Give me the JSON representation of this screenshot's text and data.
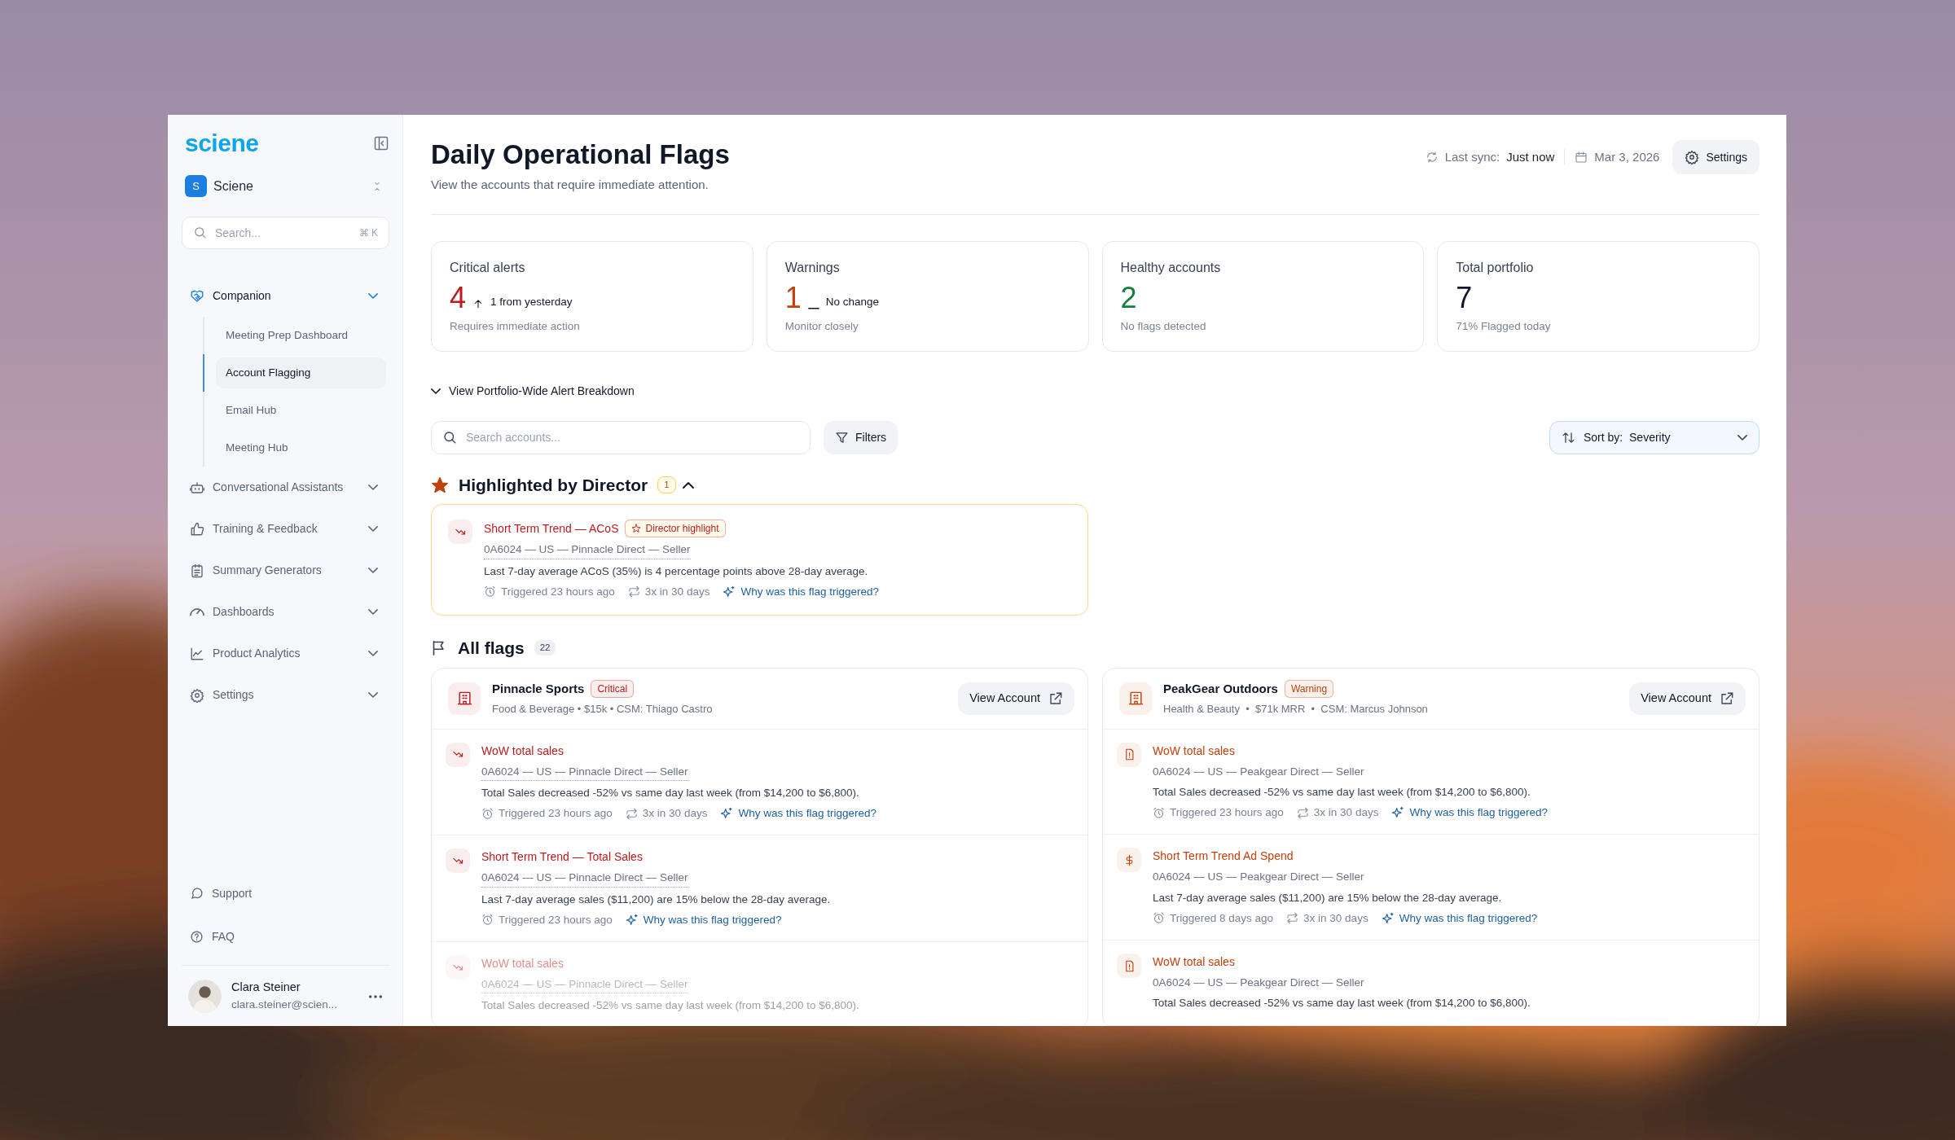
{
  "sidebar": {
    "brand": "sciene",
    "workspace": {
      "initial": "S",
      "name": "Sciene"
    },
    "search": {
      "placeholder": "Search...",
      "shortcut": "⌘ K"
    },
    "nav": [
      {
        "label": "Companion",
        "kind": "handshake",
        "expanded": true,
        "children": [
          {
            "label": "Meeting Prep Dashboard",
            "selected": false
          },
          {
            "label": "Account Flagging",
            "selected": true
          },
          {
            "label": "Email Hub",
            "selected": false
          },
          {
            "label": "Meeting Hub",
            "selected": false
          }
        ]
      },
      {
        "label": "Conversational Assistants",
        "kind": "robot",
        "expanded": false
      },
      {
        "label": "Training & Feedback",
        "kind": "thumbs",
        "expanded": false
      },
      {
        "label": "Summary Generators",
        "kind": "clipboard",
        "expanded": false
      },
      {
        "label": "Dashboards",
        "kind": "gauge",
        "expanded": false
      },
      {
        "label": "Product Analytics",
        "kind": "chart",
        "expanded": false
      },
      {
        "label": "Settings",
        "kind": "gear",
        "expanded": false
      }
    ],
    "footer_links": [
      {
        "label": "Support",
        "kind": "chat"
      },
      {
        "label": "FAQ",
        "kind": "question"
      }
    ],
    "user": {
      "name": "Clara Steiner",
      "email": "clara.steiner@scien..."
    }
  },
  "header": {
    "title": "Daily Operational Flags",
    "subtitle": "View the accounts that require immediate attention.",
    "sync_label": "Last sync:",
    "sync_value": "Just now",
    "date": "Mar 3, 2026",
    "settings_button": "Settings"
  },
  "stats": [
    {
      "label": "Critical alerts",
      "value": "4",
      "color": "#b91c1c",
      "delta": {
        "kind": "up",
        "text": "1 from yesterday"
      },
      "note": "Requires immediate action"
    },
    {
      "label": "Warnings",
      "value": "1",
      "color": "#c2410c",
      "delta": {
        "kind": "flat",
        "text": "No change"
      },
      "note": "Monitor closely"
    },
    {
      "label": "Healthy accounts",
      "value": "2",
      "color": "#15803d",
      "note": "No flags detected"
    },
    {
      "label": "Total portfolio",
      "value": "7",
      "color": "#111827",
      "note": "71% Flagged today"
    }
  ],
  "breakdown_toggle": {
    "label": "View Portfolio-Wide Alert Breakdown",
    "expanded": false
  },
  "toolbar": {
    "search_placeholder": "Search accounts...",
    "filters_button": "Filters",
    "sort_label": "Sort by:",
    "sort_value": "Severity"
  },
  "highlighted": {
    "title": "Highlighted by Director",
    "count": "1",
    "expanded": true,
    "items": [
      {
        "kind": "trend",
        "color": "#b91c1c",
        "title": "Short Term Trend — ACoS",
        "badge": "Director highlight",
        "source": "0A6024 — US — Pinnacle Direct — Seller",
        "underlined": true,
        "description": "Last 7-day average ACoS (35%) is 4 percentage points above 28-day average.",
        "triggered": "Triggered 23 hours ago",
        "repeat": "3x in 30 days",
        "link": "Why was this flag triggered?",
        "faded": false
      }
    ]
  },
  "all_flags": {
    "title": "All flags",
    "count": "22",
    "accounts": [
      {
        "name": "Pinnacle Sports",
        "color": "#b91c1c",
        "badge": "Critical",
        "meta": "Food & Beverage • $15k • CSM: Thiago Castro",
        "button": "View Account",
        "flags": [
          {
            "kind": "trend",
            "title": "WoW total sales",
            "source": "0A6024 — US — Pinnacle Direct — Seller",
            "underlined": true,
            "description": "Total Sales decreased -52% vs same day last week (from $14,200 to $6,800).",
            "triggered": "Triggered 23 hours ago",
            "repeat": "3x in 30 days",
            "link": "Why was this flag triggered?",
            "faded": false
          },
          {
            "kind": "trend",
            "title": "Short Term Trend — Total Sales",
            "source": "0A6024 — US — Pinnacle Direct — Seller",
            "underlined": true,
            "description": "Last 7-day average sales ($11,200) are 15% below the 28-day average.",
            "triggered": "Triggered 23 hours ago",
            "link": "Why was this flag triggered?",
            "faded": false
          },
          {
            "kind": "trend",
            "title": "WoW total sales",
            "source": "0A6024 — US — Pinnacle Direct — Seller",
            "underlined": true,
            "description": "Total Sales decreased -52% vs same day last week (from $14,200 to $6,800).",
            "faded": true
          }
        ]
      },
      {
        "name": "PeakGear Outdoors",
        "color": "#c2410c",
        "badge": "Warning",
        "meta": "Health & Beauty  •  $71k MRR  •  CSM: Marcus Johnson",
        "button": "View Account",
        "flags": [
          {
            "kind": "alert",
            "title": "WoW total sales",
            "source": "0A6024 — US — Peakgear Direct — Seller",
            "underlined": false,
            "description": "Total Sales decreased -52% vs same day last week (from $14,200 to $6,800).",
            "triggered": "Triggered 23 hours ago",
            "repeat": "3x in 30 days",
            "link": "Why was this flag triggered?",
            "faded": false
          },
          {
            "kind": "spend",
            "title": "Short Term Trend Ad Spend",
            "source": "0A6024 — US — Peakgear Direct — Seller",
            "underlined": false,
            "description": "Last 7-day average sales ($11,200) are 15% below the 28-day average.",
            "triggered": "Triggered 8 days ago",
            "repeat": "3x in 30 days",
            "link": "Why was this flag triggered?",
            "faded": false
          },
          {
            "kind": "alert",
            "title": "WoW total sales",
            "source": "0A6024 — US — Peakgear Direct — Seller",
            "underlined": false,
            "description": "Total Sales decreased -52% vs same day last week (from $14,200 to $6,800).",
            "faded": false
          }
        ]
      }
    ]
  }
}
